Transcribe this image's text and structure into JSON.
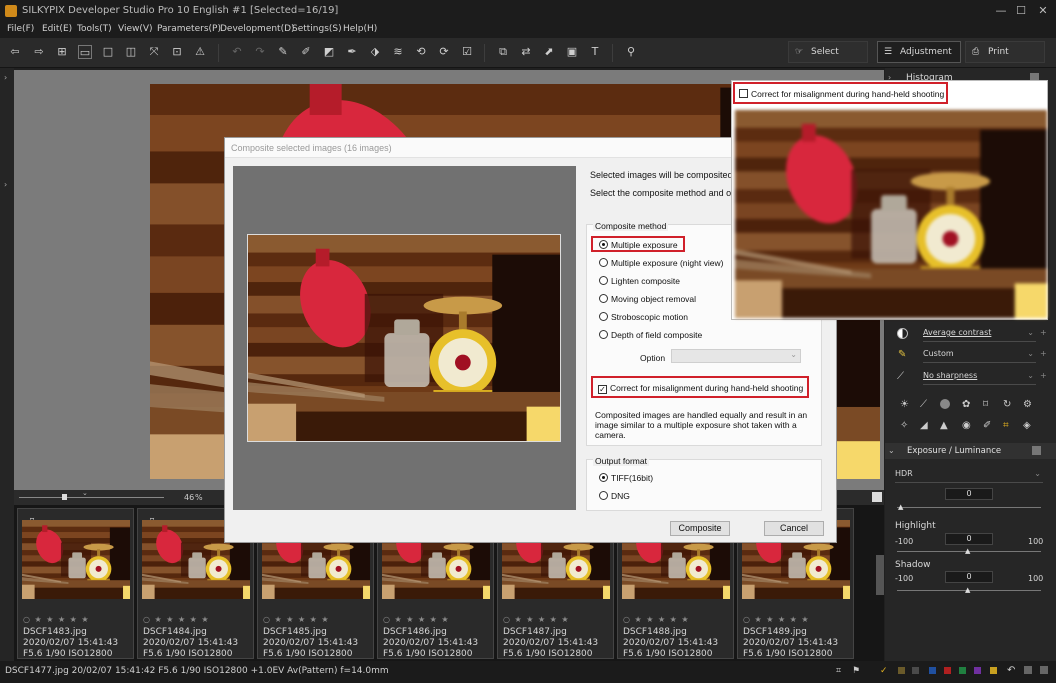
{
  "window": {
    "title": "SILKYPIX Developer Studio Pro 10 English   #1   [Selected=16/19]",
    "minimize": "—",
    "maximize": "☐",
    "close": "✕"
  },
  "menu": [
    "File(F)",
    "Edit(E)",
    "Tools(T)",
    "View(V)",
    "Parameters(P)",
    "Development(D)",
    "Settings(S)",
    "Help(H)"
  ],
  "modes": {
    "select": "Select",
    "adjustment": "Adjustment",
    "print": "Print"
  },
  "zoom": {
    "value": "46",
    "unit": "%"
  },
  "thumbnails": [
    {
      "name": "DSCF1483.jpg",
      "date": "2020/02/07 15:41:43",
      "exif": "F5.6 1/90 ISO12800",
      "stars": "○ ★ ★ ★ ★ ★",
      "mark": "⌑"
    },
    {
      "name": "DSCF1484.jpg",
      "date": "2020/02/07 15:41:43",
      "exif": "F5.6 1/90 ISO12800",
      "stars": "○ ★ ★ ★ ★ ★",
      "mark": "⌑"
    },
    {
      "name": "DSCF1485.jpg",
      "date": "2020/02/07 15:41:43",
      "exif": "F5.6 1/90 ISO12800",
      "stars": "○ ★ ★ ★ ★ ★",
      "mark": ""
    },
    {
      "name": "DSCF1486.jpg",
      "date": "2020/02/07 15:41:43",
      "exif": "F5.6 1/90 ISO12800",
      "stars": "○ ★ ★ ★ ★ ★",
      "mark": ""
    },
    {
      "name": "DSCF1487.jpg",
      "date": "2020/02/07 15:41:43",
      "exif": "F5.6 1/90 ISO12800",
      "stars": "○ ★ ★ ★ ★ ★",
      "mark": ""
    },
    {
      "name": "DSCF1488.jpg",
      "date": "2020/02/07 15:41:43",
      "exif": "F5.6 1/90 ISO12800",
      "stars": "○ ★ ★ ★ ★ ★",
      "mark": ""
    },
    {
      "name": "DSCF1489.jpg",
      "date": "2020/02/07 15:41:43",
      "exif": "F5.6 1/90 ISO12800",
      "stars": "○ ★ ★ ★ ★ ★",
      "mark": ""
    }
  ],
  "status": {
    "text": "DSCF1477.jpg 20/02/07 15:41:42 F5.6 1/90 ISO12800 +1.0EV Av(Pattern) f=14.0mm"
  },
  "right_panel": {
    "histogram": "Histogram",
    "contrast": "Average contrast",
    "tone": "Custom",
    "sharpness": "No sharpness",
    "section_exposure": "Exposure / Luminance",
    "hdr": {
      "label": "HDR",
      "value": "0"
    },
    "highlight": {
      "label": "Highlight",
      "min": "-100",
      "value": "0",
      "max": "100"
    },
    "shadow": {
      "label": "Shadow",
      "min": "-100",
      "value": "0",
      "max": "100"
    }
  },
  "dialog": {
    "title": "Composite selected images (16 images)",
    "info1": "Selected images will be composited.",
    "info2": "Select the composite method and outp",
    "method_title": "Composite method",
    "methods": [
      "Multiple exposure",
      "Multiple exposure (night view)",
      "Lighten composite",
      "Moving object removal",
      "Stroboscopic motion",
      "Depth of field composite"
    ],
    "selected_method": "Multiple exposure",
    "option_label": "Option",
    "checkbox_label": "Correct for misalignment during hand-held shooting",
    "description": [
      "Composited images are handled equally and result in an",
      "image similar to a multiple exposure shot taken with a",
      "camera."
    ],
    "output_title": "Output format",
    "formats": [
      "TIFF(16bit)",
      "DNG"
    ],
    "selected_format": "TIFF(16bit)",
    "composite_button": "Composite",
    "cancel_button": "Cancel"
  },
  "callout": {
    "checkbox_label": "Correct for misalignment during hand-held shooting"
  },
  "colors": {
    "highlight": "#d0202a",
    "dialog_bg": "#f0f0f0",
    "app_bg": "#202020"
  }
}
